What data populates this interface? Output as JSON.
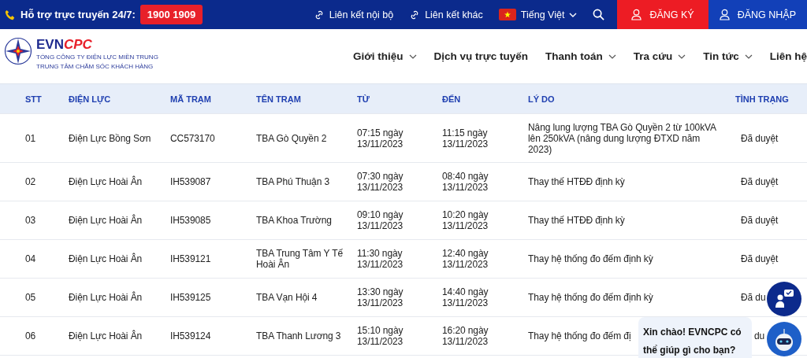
{
  "top_bar": {
    "hotline_label": "Hỗ trợ trực truyến 24/7:",
    "hotline_number": "1900 1909",
    "links": [
      "Liên kết nội bộ",
      "Liên kết khác"
    ],
    "language": "Tiếng Việt",
    "register": "ĐĂNG KÝ",
    "login": "ĐĂNG NHẬP"
  },
  "logo": {
    "brand_a": "EVN",
    "brand_b": "CPC",
    "line_1": "TỔNG CÔNG TY ĐIỆN LỰC MIỀN TRUNG",
    "line_2": "TRUNG TÂM CHĂM SÓC KHÁCH HÀNG"
  },
  "nav": [
    {
      "label": "Giới thiệu",
      "dropdown": true
    },
    {
      "label": "Dịch vụ trực tuyến",
      "dropdown": false
    },
    {
      "label": "Thanh toán",
      "dropdown": true
    },
    {
      "label": "Tra cứu",
      "dropdown": true
    },
    {
      "label": "Tin tức",
      "dropdown": true
    },
    {
      "label": "Liên hệ",
      "dropdown": false
    }
  ],
  "table": {
    "columns": [
      "STT",
      "ĐIỆN LỰC",
      "MÃ TRẠM",
      "TÊN TRẠM",
      "TỪ",
      "ĐẾN",
      "LÝ DO",
      "TÌNH TRẠNG"
    ],
    "rows": [
      [
        "01",
        "Điện Lực Bồng Sơn",
        "CC573170",
        "TBA Gò Quyền 2",
        "07:15 ngày 13/11/2023",
        "11:15 ngày 13/11/2023",
        "Nâng lung lượng TBA Gò Quyền 2 từ 100kVA lên 250kVA (nâng dung lượng ĐTXD năm 2023)",
        "Đã duyệt"
      ],
      [
        "02",
        "Điện Lực Hoài Ân",
        "IH539087",
        "TBA Phú Thuận 3",
        "07:30 ngày 13/11/2023",
        "08:40 ngày 13/11/2023",
        "Thay thế HTĐĐ định kỳ",
        "Đã duyệt"
      ],
      [
        "03",
        "Điện Lực Hoài Ân",
        "IH539085",
        "TBA Khoa Trường",
        "09:10 ngày 13/11/2023",
        "10:20 ngày 13/11/2023",
        "Thay thế HTĐĐ định kỳ",
        "Đã duyệt"
      ],
      [
        "04",
        "Điện Lực Hoài Ân",
        "IH539121",
        "TBA Trung Tâm Y Tế Hoài Ân",
        "11:30 ngày 13/11/2023",
        "12:40 ngày 13/11/2023",
        "Thay hệ thống đo đếm định kỳ",
        "Đã duyệt"
      ],
      [
        "05",
        "Điện Lực Hoài Ân",
        "IH539125",
        "TBA Vạn Hội 4",
        "13:30 ngày 13/11/2023",
        "14:40 ngày 13/11/2023",
        "Thay hệ thống đo đếm định kỳ",
        "Đã du"
      ],
      [
        "06",
        "Điện Lực Hoài Ân",
        "IH539124",
        "TBA Thanh Lương 3",
        "15:10 ngày 13/11/2023",
        "16:20 ngày 13/11/2023",
        "Thay hệ thống đo đếm đị",
        "du"
      ]
    ]
  },
  "chat": {
    "greeting": "Xin chào! EVNCPC có thể giúp gì cho bạn?"
  }
}
